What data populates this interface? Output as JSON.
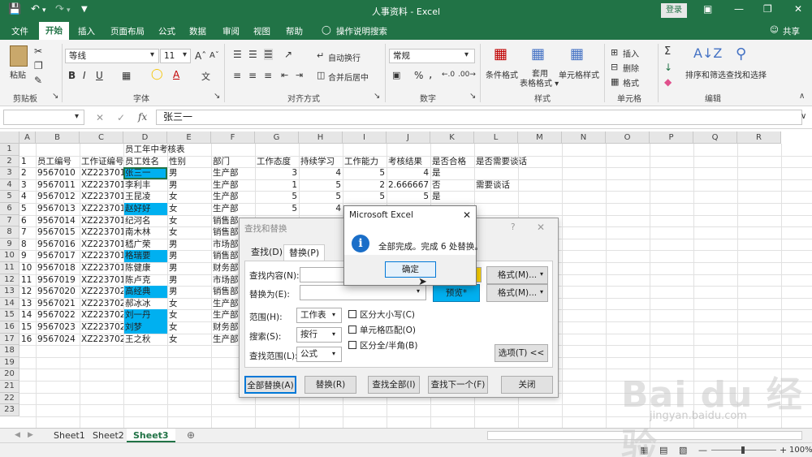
{
  "window": {
    "title": "人事资料 - Excel",
    "login": "登录"
  },
  "menu": [
    "文件",
    "开始",
    "插入",
    "页面布局",
    "公式",
    "数据",
    "审阅",
    "视图",
    "帮助",
    "操作说明搜索",
    "共享"
  ],
  "ribbon": {
    "clipboard": "剪贴板",
    "paste": "粘贴",
    "font_group": "字体",
    "font_name": "等线",
    "font_size": "11",
    "align_group": "对齐方式",
    "wrap": "自动换行",
    "merge": "合并后居中",
    "number_group": "数字",
    "number_format": "常规",
    "styles_group": "样式",
    "cond_format": "条件格式",
    "table_format": "套用\n表格格式",
    "cell_style": "单元格样式",
    "cells_group": "单元格",
    "insert": "插入",
    "delete": "删除",
    "format": "格式",
    "edit_group": "编辑",
    "sort": "排序和筛选",
    "find": "查找和选择"
  },
  "formula_bar": {
    "value": "张三一"
  },
  "columns": [
    "A",
    "B",
    "C",
    "D",
    "E",
    "F",
    "G",
    "H",
    "I",
    "J",
    "K",
    "L",
    "M",
    "N",
    "O",
    "P",
    "Q",
    "R"
  ],
  "rows": [
    {
      "n": "1",
      "cells": {
        "D": "员工年中考核表"
      }
    },
    {
      "n": "2",
      "cells": {
        "A": "1",
        "B": "员工编号",
        "C": "工作证编号",
        "D": "员工姓名",
        "E": "性别",
        "F": "部门",
        "G": "工作态度",
        "H": "持续学习",
        "I": "工作能力",
        "J": "考核结果",
        "K": "是否合格",
        "L": "是否需要谈话"
      }
    },
    {
      "n": "3",
      "cells": {
        "A": "2",
        "B": "9567010",
        "C": "XZ223701",
        "D": "张三一",
        "E": "男",
        "F": "生产部",
        "G": "3",
        "H": "4",
        "I": "5",
        "J": "4",
        "K": "是"
      }
    },
    {
      "n": "4",
      "cells": {
        "A": "3",
        "B": "9567011",
        "C": "XZ223701",
        "D": "李利丰",
        "E": "男",
        "F": "生产部",
        "G": "1",
        "H": "5",
        "I": "2",
        "J": "2.666667",
        "K": "否",
        "L": "需要谈话"
      }
    },
    {
      "n": "5",
      "cells": {
        "A": "4",
        "B": "9567012",
        "C": "XZ223701",
        "D": "王昆凌",
        "E": "女",
        "F": "生产部",
        "G": "5",
        "H": "5",
        "I": "5",
        "J": "5",
        "K": "是"
      }
    },
    {
      "n": "6",
      "cells": {
        "A": "5",
        "B": "9567013",
        "C": "XZ223701",
        "D": "赵好好",
        "E": "女",
        "F": "生产部",
        "G": "5",
        "H": "4"
      }
    },
    {
      "n": "7",
      "cells": {
        "A": "6",
        "B": "9567014",
        "C": "XZ223701",
        "D": "纪河名",
        "E": "女",
        "F": "销售部"
      }
    },
    {
      "n": "8",
      "cells": {
        "A": "7",
        "B": "9567015",
        "C": "XZ223701",
        "D": "南木林",
        "E": "女",
        "F": "销售部"
      }
    },
    {
      "n": "9",
      "cells": {
        "A": "8",
        "B": "9567016",
        "C": "XZ223701",
        "D": "嵇广荣",
        "E": "男",
        "F": "市场部"
      }
    },
    {
      "n": "10",
      "cells": {
        "A": "9",
        "B": "9567017",
        "C": "XZ223701",
        "D": "格瑞要",
        "E": "男",
        "F": "销售部"
      }
    },
    {
      "n": "11",
      "cells": {
        "A": "10",
        "B": "9567018",
        "C": "XZ223701",
        "D": "陈健康",
        "E": "男",
        "F": "财务部"
      }
    },
    {
      "n": "12",
      "cells": {
        "A": "11",
        "B": "9567019",
        "C": "XZ223701",
        "D": "陈卢克",
        "E": "男",
        "F": "市场部"
      }
    },
    {
      "n": "13",
      "cells": {
        "A": "12",
        "B": "9567020",
        "C": "XZ223702",
        "D": "高经典",
        "E": "男",
        "F": "销售部"
      }
    },
    {
      "n": "14",
      "cells": {
        "A": "13",
        "B": "9567021",
        "C": "XZ223702",
        "D": "郝冰冰",
        "E": "女",
        "F": "生产部"
      }
    },
    {
      "n": "15",
      "cells": {
        "A": "14",
        "B": "9567022",
        "C": "XZ223702",
        "D": "刘一丹",
        "E": "女",
        "F": "生产部"
      }
    },
    {
      "n": "16",
      "cells": {
        "A": "15",
        "B": "9567023",
        "C": "XZ223702",
        "D": "刘梦",
        "E": "女",
        "F": "财务部"
      }
    },
    {
      "n": "17",
      "cells": {
        "A": "16",
        "B": "9567024",
        "C": "XZ223702",
        "D": "王之秋",
        "E": "女",
        "F": "生产部"
      }
    },
    {
      "n": "18",
      "cells": {}
    },
    {
      "n": "19",
      "cells": {}
    },
    {
      "n": "20",
      "cells": {}
    },
    {
      "n": "21",
      "cells": {}
    },
    {
      "n": "22",
      "cells": {}
    },
    {
      "n": "23",
      "cells": {}
    }
  ],
  "highlight_rows": [
    "3",
    "6",
    "10",
    "13",
    "15",
    "16"
  ],
  "sheets": [
    "Sheet1",
    "Sheet2",
    "Sheet3"
  ],
  "zoom": "100%",
  "find_dialog": {
    "title": "查找和替换",
    "tab_find": "查找(D)",
    "tab_replace": "替换(P)",
    "find_label": "查找内容(N):",
    "replace_label": "替换为(E):",
    "format1": "格式(M)...",
    "format2": "格式(M)...",
    "preview": "预览*",
    "scope_label": "范围(H):",
    "scope_val": "工作表",
    "search_label": "搜索(S):",
    "search_val": "按行",
    "lookin_label": "查找范围(L):",
    "lookin_val": "公式",
    "match_case": "区分大小写(C)",
    "match_cell": "单元格匹配(O)",
    "match_width": "区分全/半角(B)",
    "options": "选项(T) <<",
    "replace_all": "全部替换(A)",
    "replace": "替换(R)",
    "find_all": "查找全部(I)",
    "find_next": "查找下一个(F)",
    "close": "关闭"
  },
  "msgbox": {
    "title": "Microsoft Excel",
    "message": "全部完成。完成 6 处替换。",
    "ok": "确定"
  },
  "watermark": {
    "main": "Bai du 经验",
    "sub": "jingyan.baidu.com"
  }
}
